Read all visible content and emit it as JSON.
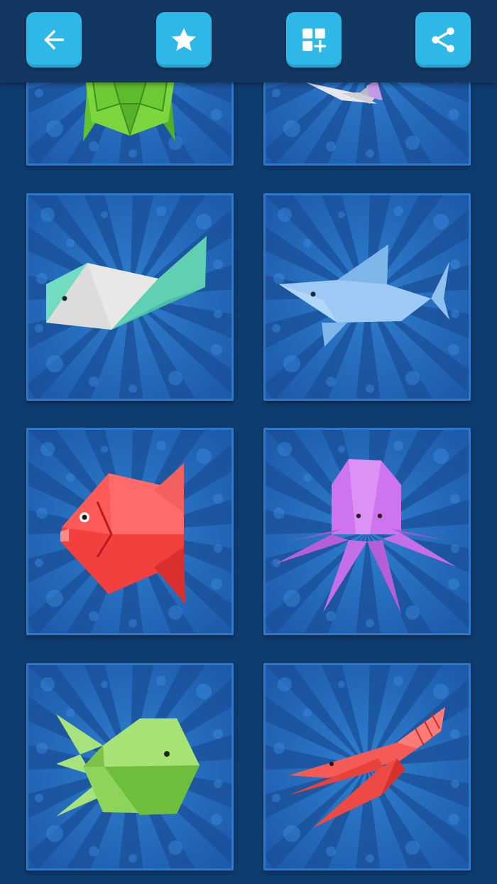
{
  "toolbar": {
    "buttons": [
      {
        "name": "back-button",
        "icon": "arrow-left-icon"
      },
      {
        "name": "favorite-button",
        "icon": "star-icon"
      },
      {
        "name": "more-apps-button",
        "icon": "grid-plus-icon"
      },
      {
        "name": "share-button",
        "icon": "share-icon"
      }
    ],
    "button_color": "#2eb8e8",
    "bar_color": "#123761"
  },
  "tiles": [
    {
      "animal": "turtle",
      "color": "#6fd13a"
    },
    {
      "animal": "dolphin",
      "color": "#c9b9f0"
    },
    {
      "animal": "whale",
      "color": "#6fdcc0"
    },
    {
      "animal": "shark",
      "color": "#8ec0ee"
    },
    {
      "animal": "sunfish",
      "color": "#f2403f"
    },
    {
      "animal": "octopus",
      "color": "#c46ee8"
    },
    {
      "animal": "fish",
      "color": "#8fd45a"
    },
    {
      "animal": "shrimp",
      "color": "#f04a46"
    }
  ],
  "colors": {
    "background": "#0f3c6e",
    "tile_background": "#2265b5"
  }
}
